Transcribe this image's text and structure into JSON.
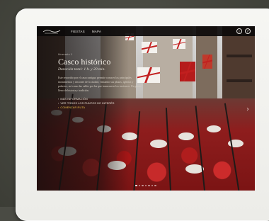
{
  "nav": {
    "items": [
      {
        "label": "Fiestas"
      },
      {
        "label": "Mapa"
      }
    ],
    "info_icon": "info-icon",
    "help_icon": "help-icon",
    "help_glyph": "?",
    "info_glyph": "i"
  },
  "panel": {
    "kicker": "Itinerario 1",
    "title": "Casco histórico",
    "subtitle": "Duración total: 1 h. y 20 min.",
    "body": "Este recorrido por el casco antiguo permite conocer los principales monumentos y rincones de la ciudad, visitando sus plazas, iglesias y palacios, así como las calles por las que transcurren los encierros. Un paseo lleno de historia y tradición.",
    "links": [
      {
        "label": "Más información",
        "accent": false
      },
      {
        "label": "Ver todos los puntos de interés",
        "accent": false
      },
      {
        "label": "Comenzar ruta",
        "accent": true
      }
    ]
  },
  "pagination": {
    "count": 7,
    "active_index": 0
  },
  "colors": {
    "accent": "#f0c34a",
    "bar": "#0c0a0a"
  }
}
